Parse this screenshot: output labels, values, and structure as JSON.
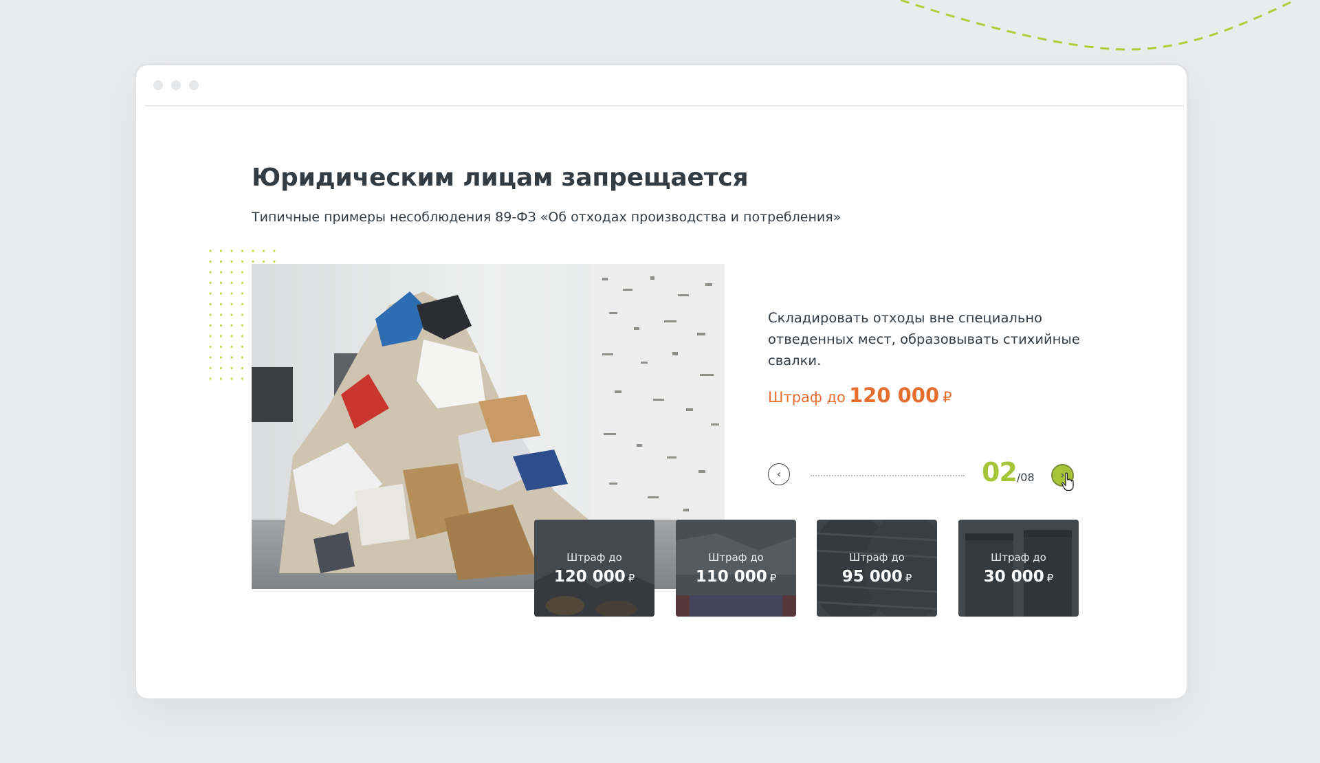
{
  "page": {
    "heading": "Юридическим лицам запрещается",
    "subtitle": "Типичные примеры несоблюдения 89-ФЗ «Об отходах производства и потребления»"
  },
  "slide": {
    "description": "Складировать отходы вне специально отведенных мест, образовывать стихийные свалки.",
    "fine_label": "Штраф до",
    "fine_value": "120 000",
    "currency": "₽"
  },
  "pager": {
    "current": "02",
    "total": "/08"
  },
  "thumbnails": [
    {
      "label": "Штраф до",
      "value": "120 000",
      "currency": "₽"
    },
    {
      "label": "Штраф до",
      "value": "110 000",
      "currency": "₽"
    },
    {
      "label": "Штраф до",
      "value": "95 000",
      "currency": "₽"
    },
    {
      "label": "Штраф до",
      "value": "30 000",
      "currency": "₽"
    }
  ],
  "icons": {
    "prev": "chevron-left-icon",
    "next": "chevron-right-icon",
    "cursor": "hand-pointer-icon"
  },
  "colors": {
    "accent_green": "#a6c437",
    "fine_orange": "#e56d2e",
    "text_dark": "#333b43",
    "background": "#eaebec"
  }
}
